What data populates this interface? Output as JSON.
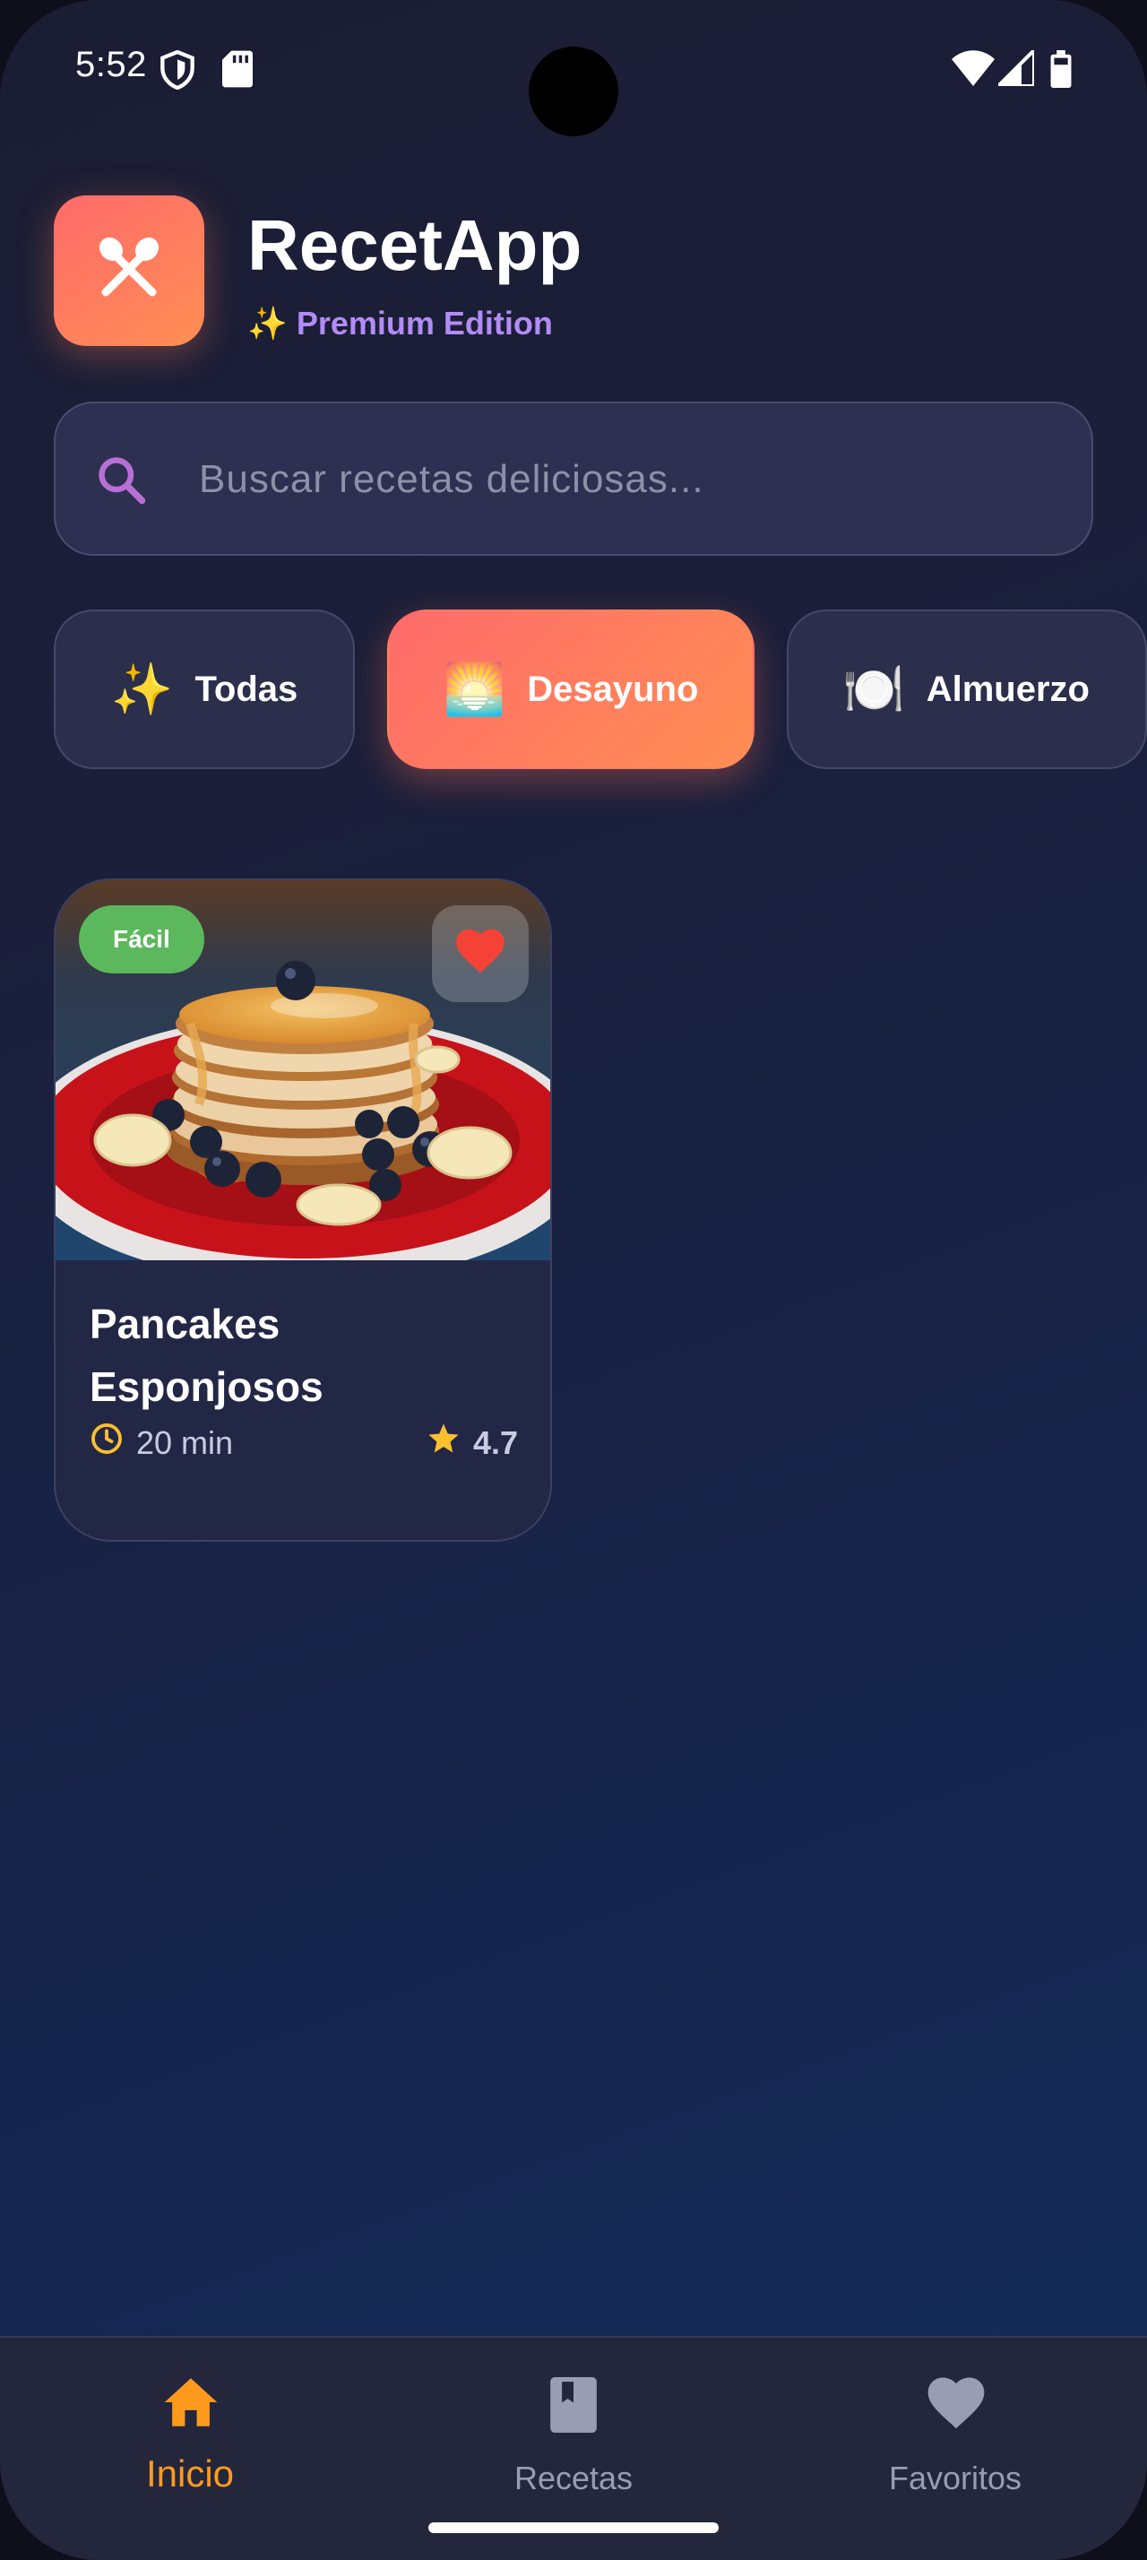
{
  "status_bar": {
    "time": "5:52",
    "icons": [
      "shield-icon",
      "sd-card-icon",
      "wifi-icon",
      "signal-icon",
      "battery-icon"
    ]
  },
  "header": {
    "app_name": "RecetApp",
    "subtitle": "✨ Premium Edition",
    "logo_icon": "fork-spoon-icon",
    "logo_color_start": "#ff6b6b",
    "logo_color_end": "#ff8e53"
  },
  "search": {
    "placeholder": "Buscar recetas deliciosas...",
    "value": ""
  },
  "categories": [
    {
      "emoji": "✨",
      "label": "Todas",
      "active": false
    },
    {
      "emoji": "🌅",
      "label": "Desayuno",
      "active": true
    },
    {
      "emoji": "🍽️",
      "label": "Almuerzo",
      "active": false
    }
  ],
  "recipes": [
    {
      "difficulty": "Fácil",
      "title": "Pancakes Esponjosos",
      "time": "20 min",
      "rating": "4.7",
      "favorite": true
    }
  ],
  "bottom_nav": [
    {
      "label": "Inicio",
      "icon": "home-icon",
      "active": true
    },
    {
      "label": "Recetas",
      "icon": "book-icon",
      "active": false
    },
    {
      "label": "Favoritos",
      "icon": "heart-icon",
      "active": false
    }
  ],
  "colors": {
    "accent": "#ff9a1f",
    "easy_badge": "#5cb85c",
    "favorite": "#f44336",
    "rating_star": "#fbc02d",
    "subtitle": "#b28cf5"
  }
}
